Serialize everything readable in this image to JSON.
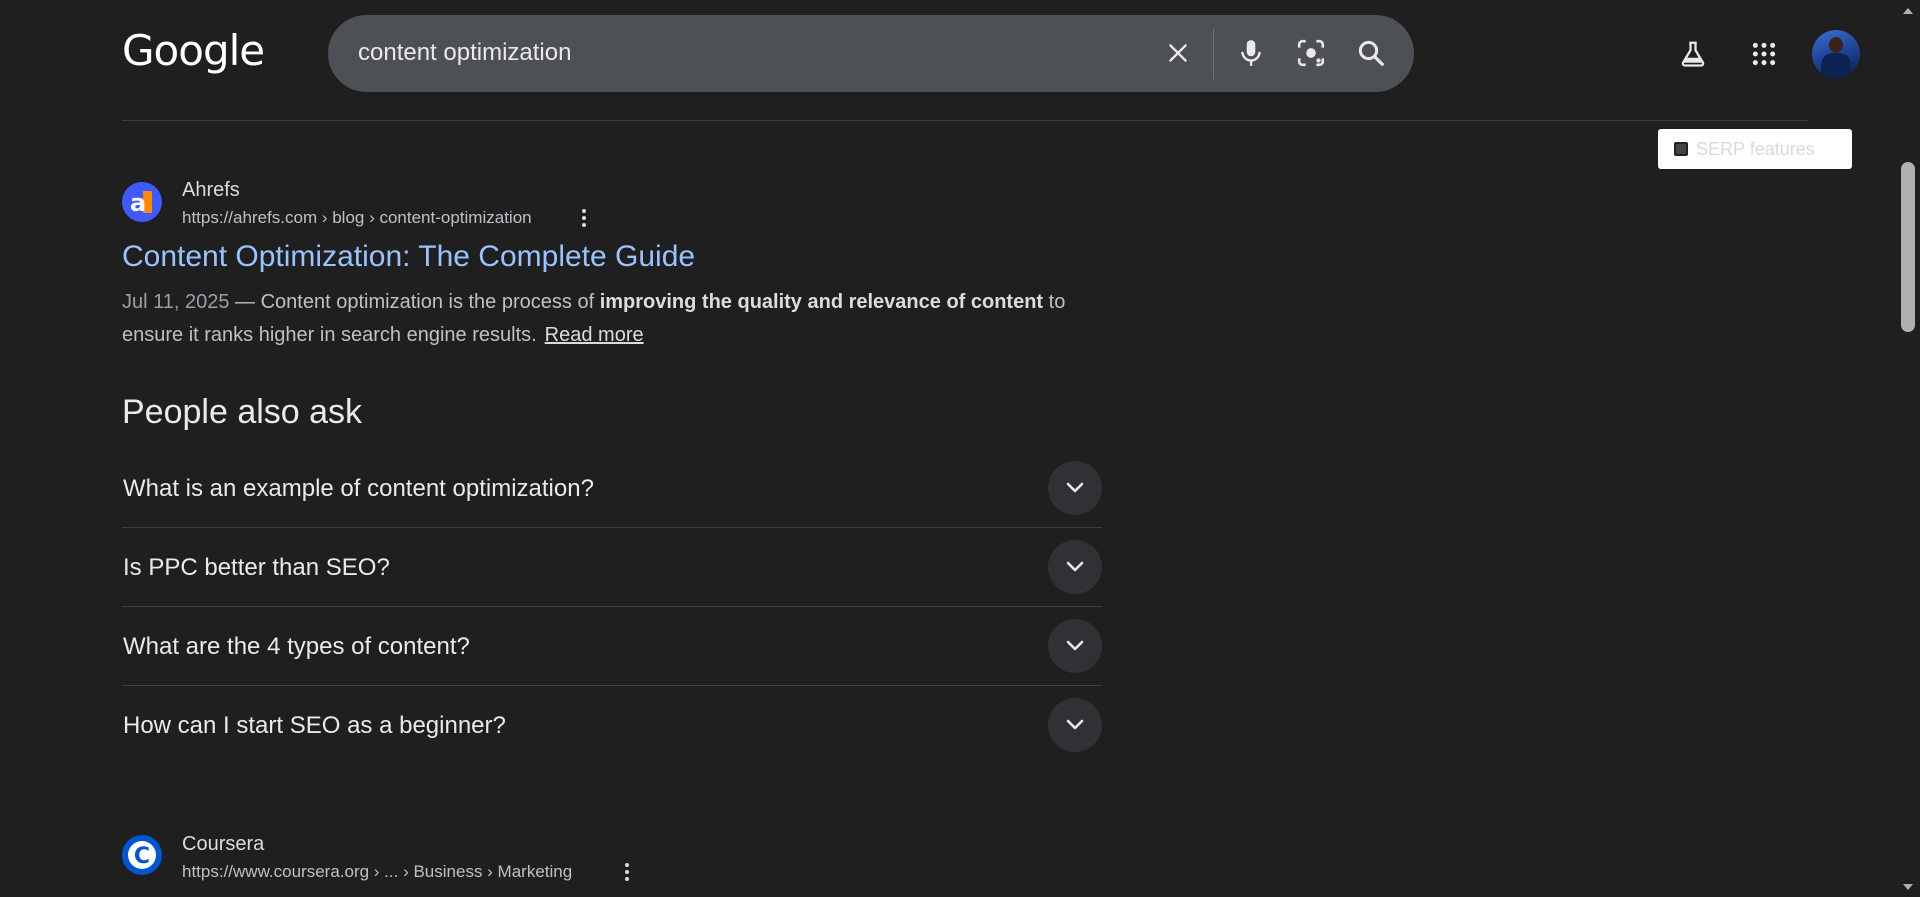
{
  "header": {
    "logo_text": "Google",
    "search_value": "content optimization",
    "icons": [
      "clear-icon",
      "microphone-icon",
      "lens-icon",
      "search-icon",
      "labs-flask-icon",
      "apps-grid-icon"
    ]
  },
  "serp_features": {
    "label": "SERP features",
    "checked": false
  },
  "results": [
    {
      "site_name": "Ahrefs",
      "url": "https://ahrefs.com › blog › content-optimization",
      "title": "Content Optimization: The Complete Guide",
      "date": "Jul 11, 2025",
      "snippet_pre": " — Content optimization is the process of ",
      "snippet_bold": "improving the quality and relevance of content",
      "snippet_post": " to ensure it ranks higher in search engine results.",
      "read_more": "Read more",
      "favicon_letter": "a"
    },
    {
      "site_name": "Coursera",
      "url": "https://www.coursera.org › ... › Business › Marketing",
      "favicon_letter": "C"
    }
  ],
  "people_also_ask": {
    "title": "People also ask",
    "questions": [
      "What is an example of content optimization?",
      "Is PPC better than SEO?",
      "What are the 4 types of content?",
      "How can I start SEO as a beginner?"
    ]
  },
  "colors": {
    "background": "#1f1f1f",
    "search_bar": "#4d5156",
    "link_title": "#99c3ff",
    "ahrefs_brand": "#3d5afe",
    "coursera_brand": "#0056d2"
  }
}
